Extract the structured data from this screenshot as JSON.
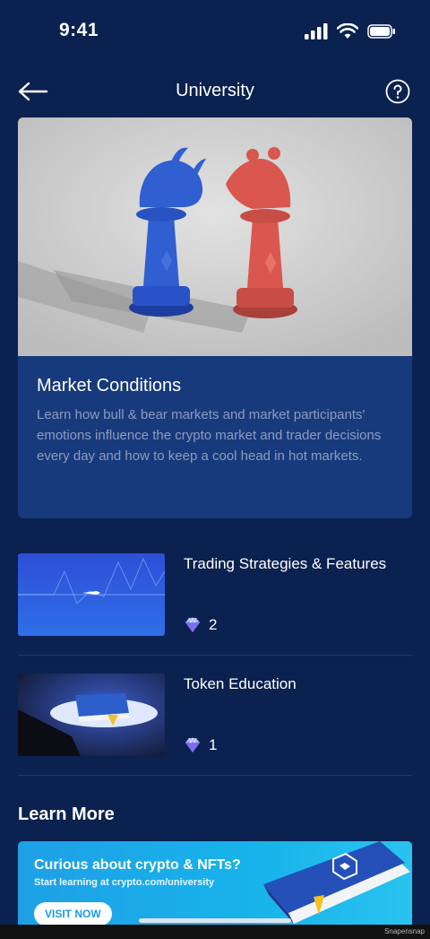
{
  "status_bar": {
    "time": "9:41"
  },
  "nav": {
    "title": "University",
    "back_icon": "arrow-left-icon",
    "help_icon": "question-circle-icon"
  },
  "featured": {
    "title": "Market Conditions",
    "description": "Learn how bull & bear markets and market participants' emotions influence the crypto market and trader decisions every day and how to keep a cool head in hot markets."
  },
  "courses": [
    {
      "title": "Trading Strategies & Features",
      "count": "2",
      "icon": "diamond-icon"
    },
    {
      "title": "Token Education",
      "count": "1",
      "icon": "diamond-icon"
    }
  ],
  "learn_more": {
    "title": "Learn More",
    "banner": {
      "headline": "Curious about crypto & NFTs?",
      "subline": "Start learning at crypto.com/university",
      "button": "VISIT NOW"
    }
  },
  "watermark": "Snapensnap",
  "colors": {
    "background": "#0b2150",
    "card": "#173a7c",
    "accent": "#1a9ae0",
    "bull": "#2f5fd0",
    "bear": "#d9574e"
  }
}
